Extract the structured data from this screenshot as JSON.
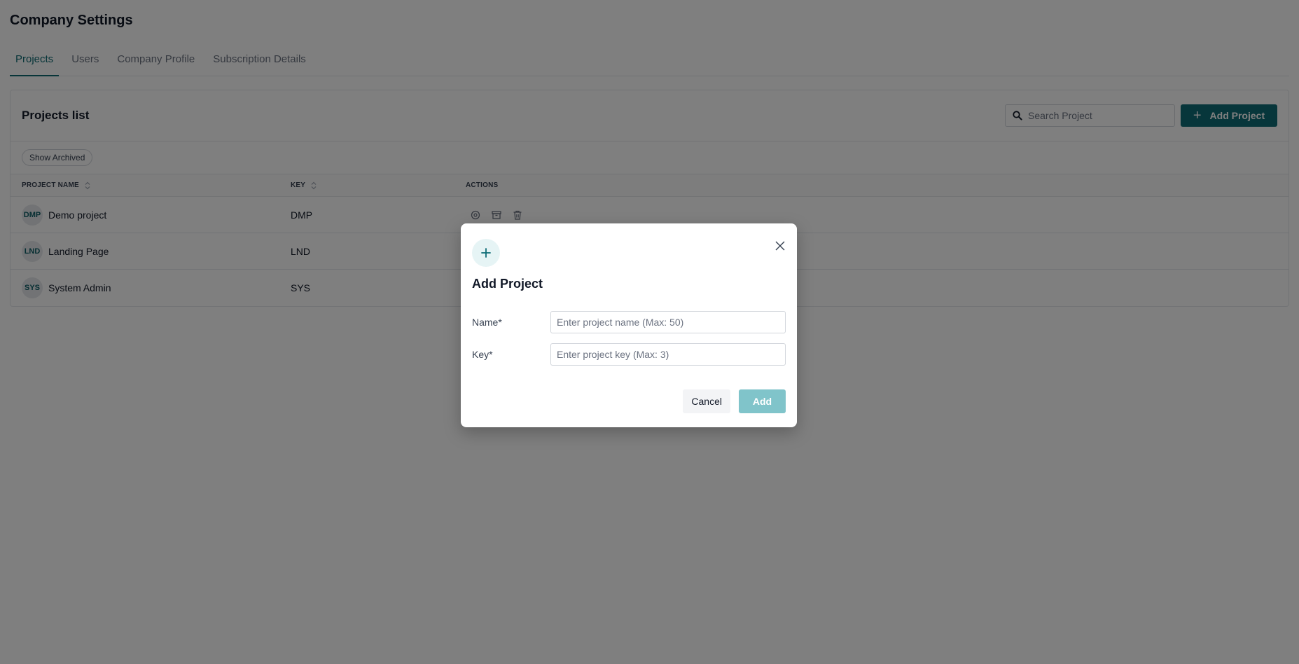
{
  "page": {
    "title": "Company Settings"
  },
  "tabs": [
    {
      "label": "Projects",
      "active": true
    },
    {
      "label": "Users",
      "active": false
    },
    {
      "label": "Company Profile",
      "active": false
    },
    {
      "label": "Subscription Details",
      "active": false
    }
  ],
  "projects_card": {
    "title": "Projects list",
    "search_placeholder": "Search Project",
    "add_button_label": "Add Project",
    "show_archived_label": "Show Archived",
    "columns": {
      "name": "PROJECT NAME",
      "key": "KEY",
      "actions": "ACTIONS"
    },
    "rows": [
      {
        "avatar": "DMP",
        "name": "Demo project",
        "key": "DMP"
      },
      {
        "avatar": "LND",
        "name": "Landing Page",
        "key": "LND"
      },
      {
        "avatar": "SYS",
        "name": "System Admin",
        "key": "SYS"
      }
    ]
  },
  "modal": {
    "title": "Add Project",
    "name_label": "Name*",
    "name_placeholder": "Enter project name (Max: 50)",
    "key_label": "Key*",
    "key_placeholder": "Enter project key (Max: 3)",
    "cancel_label": "Cancel",
    "add_label": "Add"
  },
  "colors": {
    "accent": "#0e6d77",
    "accent_disabled": "#80c4ca",
    "overlay": "rgba(0,0,0,0.5)"
  },
  "icons": {
    "search": "search-icon",
    "plus": "plus-icon",
    "close": "close-icon",
    "settings": "settings-icon",
    "archive": "archive-icon",
    "delete": "trash-icon",
    "sort": "sort-icon"
  }
}
